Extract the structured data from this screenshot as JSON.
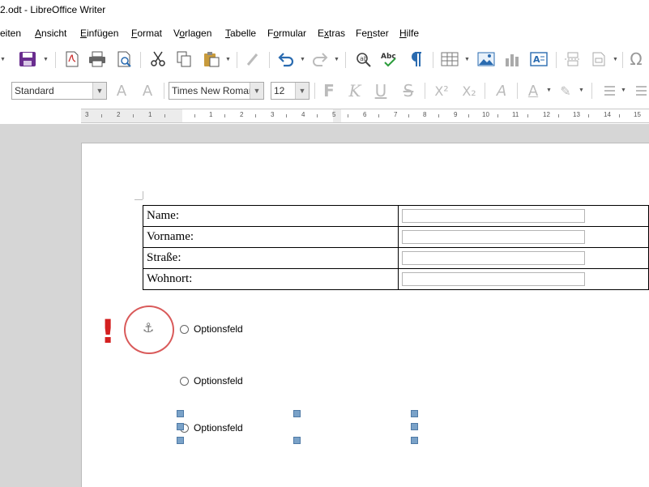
{
  "window": {
    "title": "2.odt - LibreOffice Writer"
  },
  "menubar": {
    "items": [
      {
        "label": "eiten",
        "key": ""
      },
      {
        "label": "Ansicht",
        "key": "A"
      },
      {
        "label": "Einfügen",
        "key": "E"
      },
      {
        "label": "Format",
        "key": "F"
      },
      {
        "label": "Vorlagen",
        "key": "o"
      },
      {
        "label": "Tabelle",
        "key": "T"
      },
      {
        "label": "Formular",
        "key": "o"
      },
      {
        "label": "Extras",
        "key": "x"
      },
      {
        "label": "Fenster",
        "key": "n"
      },
      {
        "label": "Hilfe",
        "key": "H"
      }
    ]
  },
  "formatting": {
    "paragraph_style": "Standard",
    "font_name": "Times New Roman",
    "font_size": "12"
  },
  "ruler": {
    "numbers": [
      "3",
      "2",
      "1",
      "1",
      "2",
      "3",
      "4",
      "5",
      "6",
      "7",
      "8",
      "9",
      "10",
      "11",
      "12",
      "13",
      "14",
      "15"
    ]
  },
  "document": {
    "table": [
      {
        "label": "Name:"
      },
      {
        "label": "Vorname:"
      },
      {
        "label": "Straße:"
      },
      {
        "label": "Wohnort:"
      }
    ],
    "radios": [
      {
        "label": "Optionsfeld"
      },
      {
        "label": "Optionsfeld"
      },
      {
        "label": "Optionsfeld"
      }
    ],
    "annotation": {
      "mark": "!",
      "anchor": "⚓"
    }
  },
  "colors": {
    "accent_red": "#d42020",
    "save_purple": "#6a2d8f",
    "handle_blue": "#7aa2c8"
  }
}
